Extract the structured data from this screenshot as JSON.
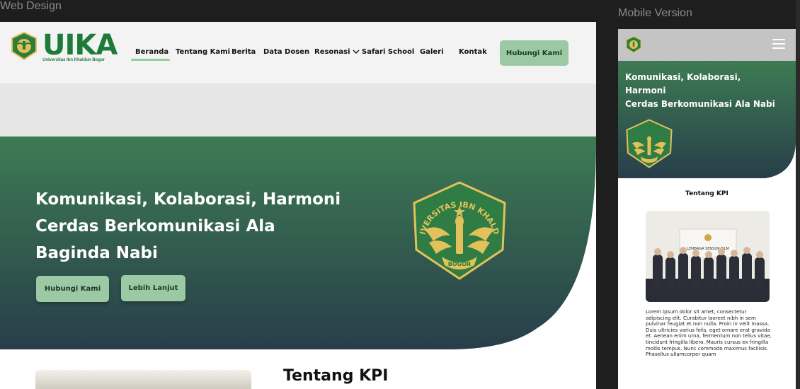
{
  "frames": {
    "web_label": "Web Design",
    "mobile_label": "Mobile Version"
  },
  "brand": {
    "logo_text": "UIKA",
    "logo_subtitle": "Universitas Ibn Khaldun Bogor",
    "emblem_ring_text": "UNIVERSITAS IBN KHALDUN",
    "emblem_banner_text": "BOGOR",
    "primary_green": "#3d7b53",
    "dark_teal": "#283e4a",
    "accent_green": "#9bc9a3",
    "emblem_gold": "#e3c15a"
  },
  "nav": {
    "items": [
      {
        "label": "Beranda",
        "active": true
      },
      {
        "label": "Tentang Kami"
      },
      {
        "label": "Berita"
      },
      {
        "label": "Data Dosen"
      },
      {
        "label": "Resonasi",
        "dropdown": true
      },
      {
        "label": "Safari School"
      },
      {
        "label": "Galeri"
      },
      {
        "label": "Kontak"
      }
    ],
    "dropdown_icon": "chevron-down-icon",
    "cta_label": "Hubungi Kami"
  },
  "hero": {
    "title_lines": [
      "Komunikasi, Kolaborasi, Harmoni",
      "Cerdas Berkomunikasi Ala",
      "Baginda Nabi"
    ],
    "primary_button": "Hubungi Kami",
    "secondary_button": "Lebih Lanjut"
  },
  "about": {
    "title": "Tentang KPI"
  },
  "mobile": {
    "menu_icon": "hamburger-menu-icon",
    "hero_title_lines": [
      "Komunikasi, Kolaborasi,",
      "Harmoni",
      "Cerdas Berkomunikasi Ala Nabi"
    ],
    "about_title": "Tentang KPI",
    "photo_caption": "LEMBAGA SENSOR FILM",
    "body_text": "Lorem ipsum dolor sit amet, consectetur adipiscing elit. Curabitur laoreet nibh in sem pulvinar feugiat et non nulla. Proin in velit massa. Duis ultricies varius felis, eget ornare erat gravida et. Aenean enim urna, fermentum non tellus vitae, tincidunt fringilla libero. Mauris cursus ex fringilla mollis tempus. Nunc commodo maximus facilisis. Phasellus ullamcorper quam"
  }
}
